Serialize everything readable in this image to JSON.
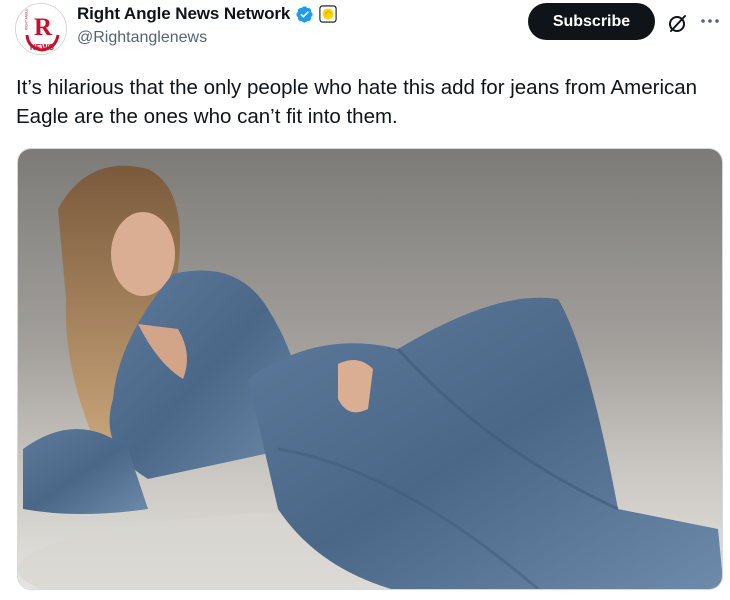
{
  "author": {
    "display_name": "Right Angle News Network",
    "handle": "@Rightanglenews",
    "verified_icon": "verified-badge-icon",
    "affiliate_icon": "affiliate-badge-icon",
    "avatar_text": "R",
    "avatar_subtext": "NEWS",
    "avatar_side_text": "RIGHT ANGLE"
  },
  "actions": {
    "subscribe_label": "Subscribe",
    "grok_icon": "grok-icon",
    "more_icon": "more-options-icon"
  },
  "tweet": {
    "text": "It’s hilarious that the only people who hate this add for jeans from American Eagle are the ones who can’t fit into them."
  },
  "media": {
    "type": "photo",
    "alt": ""
  },
  "colors": {
    "brand_red": "#c8102e",
    "verified_blue": "#1d9bf0",
    "affiliate_yellow": "#ffd400",
    "button_dark": "#0f1419",
    "secondary_text": "#536471"
  }
}
